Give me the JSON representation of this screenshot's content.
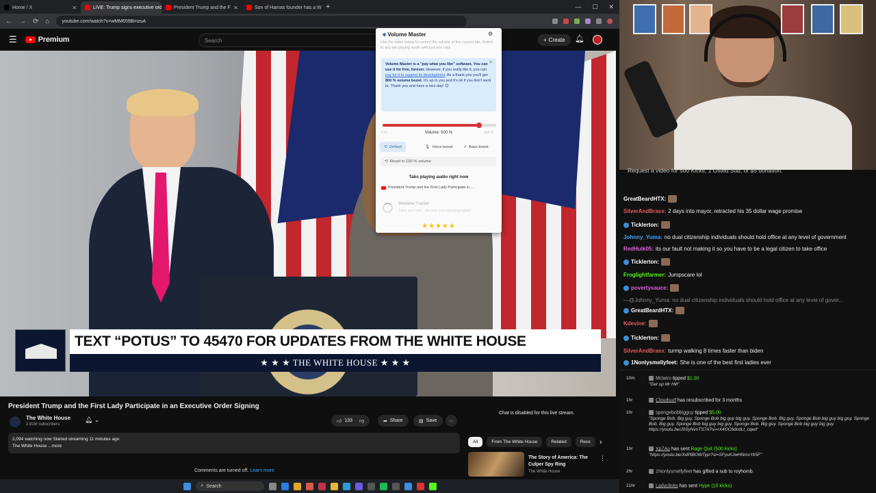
{
  "browser": {
    "tabs": [
      {
        "label": "Home / X",
        "color": "#000000",
        "active": false
      },
      {
        "label": "LIVE: Trump signs executive ord",
        "color": "#ff0000",
        "active": true
      },
      {
        "label": "President Trump and the F",
        "color": "#ff0000",
        "active": false
      },
      {
        "label": "Son of Hamas founder has a W",
        "color": "#ff0000",
        "active": false
      }
    ],
    "url": "youtube.com/watch?v=wMM659BmzuA"
  },
  "youtube": {
    "logo_label": "Premium",
    "search_placeholder": "Search",
    "create_label": "Create",
    "lower_third": {
      "headline": "TEXT “POTUS” TO 45470 FOR UPDATES FROM THE WHITE HOUSE",
      "sub": "★ ★ ★  THE WHITE HOUSE  ★ ★ ★"
    },
    "video_title": "President Trump and the First Lady Participate in an Executive Order Signing",
    "channel": {
      "name": "The White House",
      "subs": "2.81M subscribers"
    },
    "likes": "133",
    "share_label": "Share",
    "save_label": "Save",
    "description_line1": "2,094 watching now  Started streaming 11 minutes ago",
    "description_line2": "The White House ...more",
    "comments_off": "Comments are turned off.",
    "learn_more": "Learn more",
    "chat_disabled": "Chat is disabled for this live stream.",
    "chips": [
      "All",
      "From The White House",
      "Related",
      "Rece"
    ],
    "rec": {
      "title": "The Story of America: The Culper Spy Ring",
      "channel": "The White House"
    }
  },
  "volume_master": {
    "title": "Volume Master",
    "subtitle": "Use the slider below to control the volume of the current tab. Switch to any tab playing audio with just one click",
    "note_bold1": "Volume Master is a \"pay what you like\" software. You can use it for free, forever.",
    "note_text1": "However, if you really like it, you can",
    "note_link": "pay for it to support its development",
    "note_text2": ". As a thank-you you'll get",
    "note_bold2": "800 % volume boost",
    "note_text3": ". It's up to you and it's ok if you don't want to. Thank you and have a nice day! 😊",
    "slider_min": "0 %",
    "slider_max": "600 %",
    "volume_label": "Volume: 500 %",
    "volume_fraction": 0.85,
    "btn_default": "Default",
    "btn_voice": "Voice boost",
    "btn_bass": "Bass boost",
    "reset_label": "Reset to 100 % volume",
    "tabs_heading": "Tabs playing audio right now",
    "tab_playing": "President Trump and the First Lady Participate in ...",
    "ad_title": "Webtime Tracker",
    "ad_sub": "Track your time - discover your browsing habits!",
    "stars": "★★★★★"
  },
  "stream": {
    "banner": "Request a video for 500 Kicks, 1 Gifted Sub, or $5 donation.",
    "chat": [
      {
        "user": "GreatBeardHTX:",
        "color": "#ffffff",
        "text": "",
        "badge": false,
        "emote": true
      },
      {
        "user": "SilverAndBrass:",
        "color": "#e35d5d",
        "text": "2 days into mayor, retracted his 35 dollar wage promise",
        "badge": false,
        "emote": false
      },
      {
        "user": "Ticklerton:",
        "color": "#ffffff",
        "text": "",
        "badge": true,
        "emote": true
      },
      {
        "user": "Johnny_Yuma:",
        "color": "#3fa7ff",
        "text": "no dual citizenship individuals should hold office at any level of government",
        "badge": false,
        "emote": false
      },
      {
        "user": "RedHulk05:",
        "color": "#e060e0",
        "text": "its our fault not making it so you have to be a legal citizen to take office",
        "badge": false,
        "emote": false
      },
      {
        "user": "Ticklerton:",
        "color": "#ffffff",
        "text": "",
        "badge": true,
        "emote": true
      },
      {
        "user": "Froglightfarmer:",
        "color": "#53fc18",
        "text": "Jumpscare lol",
        "badge": false,
        "emote": false
      },
      {
        "user": "povertysauce:",
        "color": "#e060e0",
        "text": "",
        "badge": true,
        "emote": true
      },
      {
        "user": "",
        "color": "#888888",
        "text": "—@Johnny_Yuma: no dual citizenship individuals should hold office at any level of gover...",
        "badge": false,
        "emote": false
      },
      {
        "user": "GreatBeardHTX:",
        "color": "#ffffff",
        "text": "",
        "badge": true,
        "emote": true
      },
      {
        "user": "Kdevine:",
        "color": "#e35d5d",
        "text": "",
        "badge": false,
        "emote": true
      },
      {
        "user": "Ticklerton:",
        "color": "#ffffff",
        "text": "",
        "badge": true,
        "emote": true
      },
      {
        "user": "SilverAndBrass:",
        "color": "#e35d5d",
        "text": "turmp walking 8 times faster than biden",
        "badge": false,
        "emote": false
      },
      {
        "user": "1Nonlysmellyfeet:",
        "color": "#ffffff",
        "text": "She is one of the best first ladies ever",
        "badge": true,
        "emote": false
      }
    ],
    "events": [
      {
        "time": "10m",
        "main_user": "Mclatro",
        "main_text": "tipped",
        "amount": "$1.00",
        "sub": "\"Get up Mr Hill\""
      },
      {
        "time": "1hr",
        "main_user": "Cloudsurf",
        "main_text": "has resubscribed for 3 months",
        "amount": "",
        "sub": ""
      },
      {
        "time": "1hr",
        "main_user": "spongebobbigguy",
        "main_text": "tipped",
        "amount": "$5.00",
        "sub": "\"Sponge Bob. Big guy. Sponge Bob big guy big guy. Sponge Bob. Big guy. Sponge Bob big guy big guy. Sponge Bob. Big guy. Sponge Bob big guy big guy. Sponge Bob. Big guy. Sponge Bob big guy big guy. https://youtu.be/J0SyNvoTS7A?si=rX4OC6dcdLt_cqed\""
      },
      {
        "time": "1hr",
        "main_user": "Xp7Ao",
        "main_text": "has sent",
        "amount": "Rage Quit (500 kicks)",
        "sub": "\"https://youtu.be/XdPtBOWTyp!?si=SFyuKJwHNmxYk5F\""
      },
      {
        "time": "2hr",
        "main_user": "1Nonlysmellyfeet",
        "main_text": "has gifted a sub to royhomb.",
        "amount": "",
        "sub": ""
      },
      {
        "time": "21hr",
        "main_user": "Ladyclinks",
        "main_text": "has sent",
        "amount": "Hype (10 kicks)",
        "sub": ""
      }
    ]
  },
  "taskbar": {
    "search_label": "Search"
  }
}
